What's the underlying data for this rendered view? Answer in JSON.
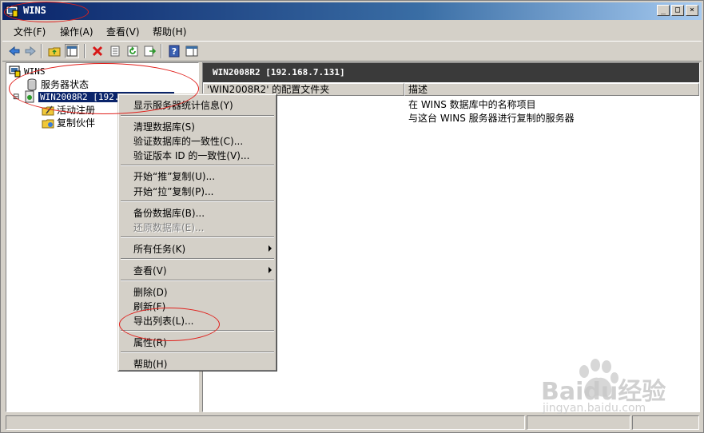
{
  "window": {
    "title": "WINS",
    "min": "_",
    "max": "□",
    "close": "×"
  },
  "menu": [
    "文件(F)",
    "操作(A)",
    "查看(V)",
    "帮助(H)"
  ],
  "tree": {
    "root": "WINS",
    "server_status": "服务器状态",
    "server_node": "WIN2008R2 [192.168.7.131]",
    "active_reg": "活动注册",
    "replication": "复制伙伴",
    "expander": "⊟"
  },
  "right": {
    "header": "WIN2008R2 [192.168.7.131]",
    "col1": "'WIN2008R2' 的配置文件夹",
    "col2": "描述",
    "rows": [
      {
        "desc": "在 WINS 数据库中的名称项目"
      },
      {
        "desc": "与这台 WINS 服务器进行复制的服务器"
      }
    ]
  },
  "context_menu": [
    "显示服务器统计信息(Y)",
    "清理数据库(S)",
    "验证数据库的一致性(C)...",
    "验证版本 ID 的一致性(V)...",
    "开始“推”复制(U)...",
    "开始“拉”复制(P)...",
    "备份数据库(B)...",
    "还原数据库(E)...",
    "所有任务(K)",
    "查看(V)",
    "删除(D)",
    "刷新(F)",
    "导出列表(L)...",
    "属性(R)",
    "帮助(H)"
  ],
  "watermark": {
    "brand": "Baidu经验",
    "url": "jingyan.baidu.com"
  },
  "colors": {
    "title_dark": "#0a246a",
    "highlight": "#0a246a",
    "annotation": "#e0201c"
  }
}
